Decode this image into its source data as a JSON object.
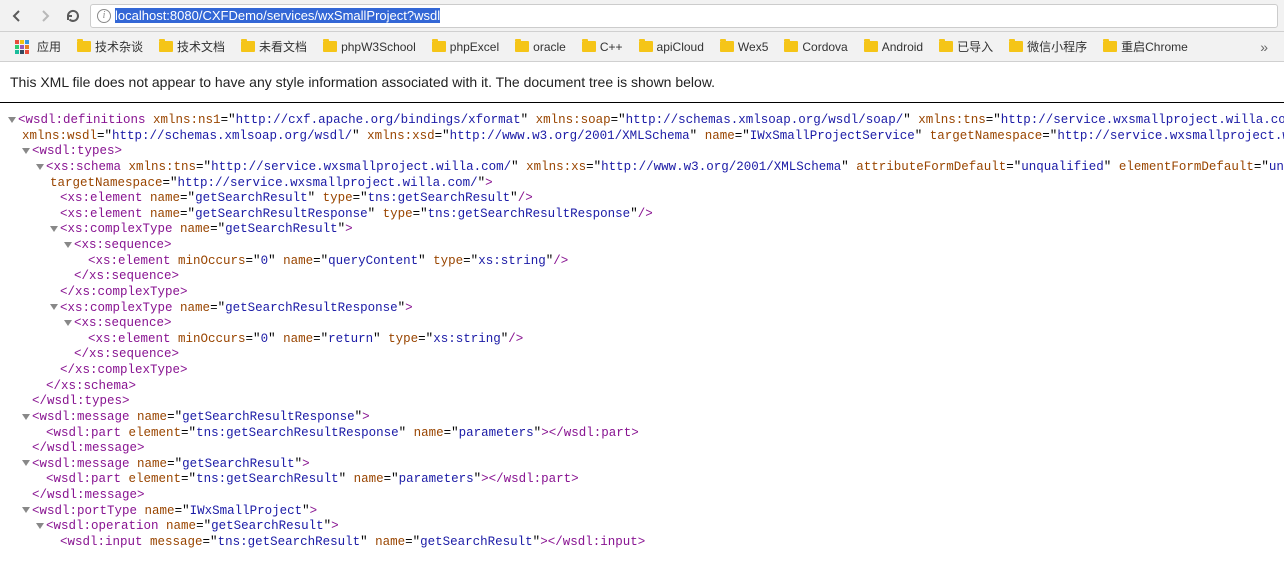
{
  "toolbar": {
    "url_prefix": "localhost:8080/CXFDemo/services/wxSmallProject?wsdl"
  },
  "bookmarks": {
    "apps": "应用",
    "items": [
      "技术杂谈",
      "技术文档",
      "未看文档",
      "phpW3School",
      "phpExcel",
      "oracle",
      "C++",
      "apiCloud",
      "Wex5",
      "Cordova",
      "Android",
      "已导入",
      "微信小程序",
      "重启Chrome"
    ],
    "overflow": "»"
  },
  "notice": "This XML file does not appear to have any style information associated with it. The document tree is shown below.",
  "xml": {
    "ns1": "http://cxf.apache.org/bindings/xformat",
    "soap": "http://schemas.xmlsoap.org/wsdl/soap/",
    "tns": "http://service.wxsmallproject.willa.com/",
    "wsdl": "http://schemas.xmlsoap.org/wsdl/",
    "xsd": "http://www.w3.org/2001/XMLSchema",
    "serviceName": "IWxSmallProjectService",
    "targetNs": "http://service.wxsmallproject.willa.com/",
    "schema_tns": "http://service.wxsmallproject.willa.com/",
    "schema_xs": "http://www.w3.org/2001/XMLSchema",
    "schema_targetNs": "http://service.wxsmallproject.willa.com/",
    "el1_name": "getSearchResult",
    "el1_type": "tns:getSearchResult",
    "el2_name": "getSearchResultResponse",
    "el2_type": "tns:getSearchResultResponse",
    "ct1_name": "getSearchResult",
    "ct1_el_name": "queryContent",
    "ct1_el_type": "xs:string",
    "ct2_name": "getSearchResultResponse",
    "ct2_el_name": "return",
    "ct2_el_type": "xs:string",
    "msg1_name": "getSearchResultResponse",
    "msg1_part_el": "tns:getSearchResultResponse",
    "msg1_part_name": "parameters",
    "msg2_name": "getSearchResult",
    "msg2_part_el": "tns:getSearchResult",
    "msg2_part_name": "parameters",
    "portType_name": "IWxSmallProject",
    "op_name": "getSearchResult",
    "input_msg": "tns:getSearchResult",
    "input_name": "getSearchResult"
  }
}
